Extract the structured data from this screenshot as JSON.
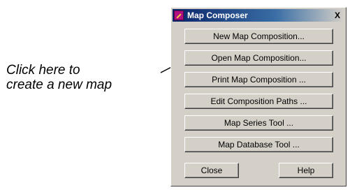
{
  "callout": {
    "line1": "Click here to",
    "line2": "create a new map"
  },
  "dialog": {
    "title": "Map Composer",
    "close_glyph": "X",
    "buttons": [
      "New Map Composition...",
      "Open Map Composition...",
      "Print Map Composition ...",
      "Edit Composition Paths ...",
      "Map Series Tool ...",
      "Map Database Tool ..."
    ],
    "close_label": "Close",
    "help_label": "Help"
  },
  "icons": {
    "app": "map-composer-icon",
    "close": "close-icon"
  }
}
